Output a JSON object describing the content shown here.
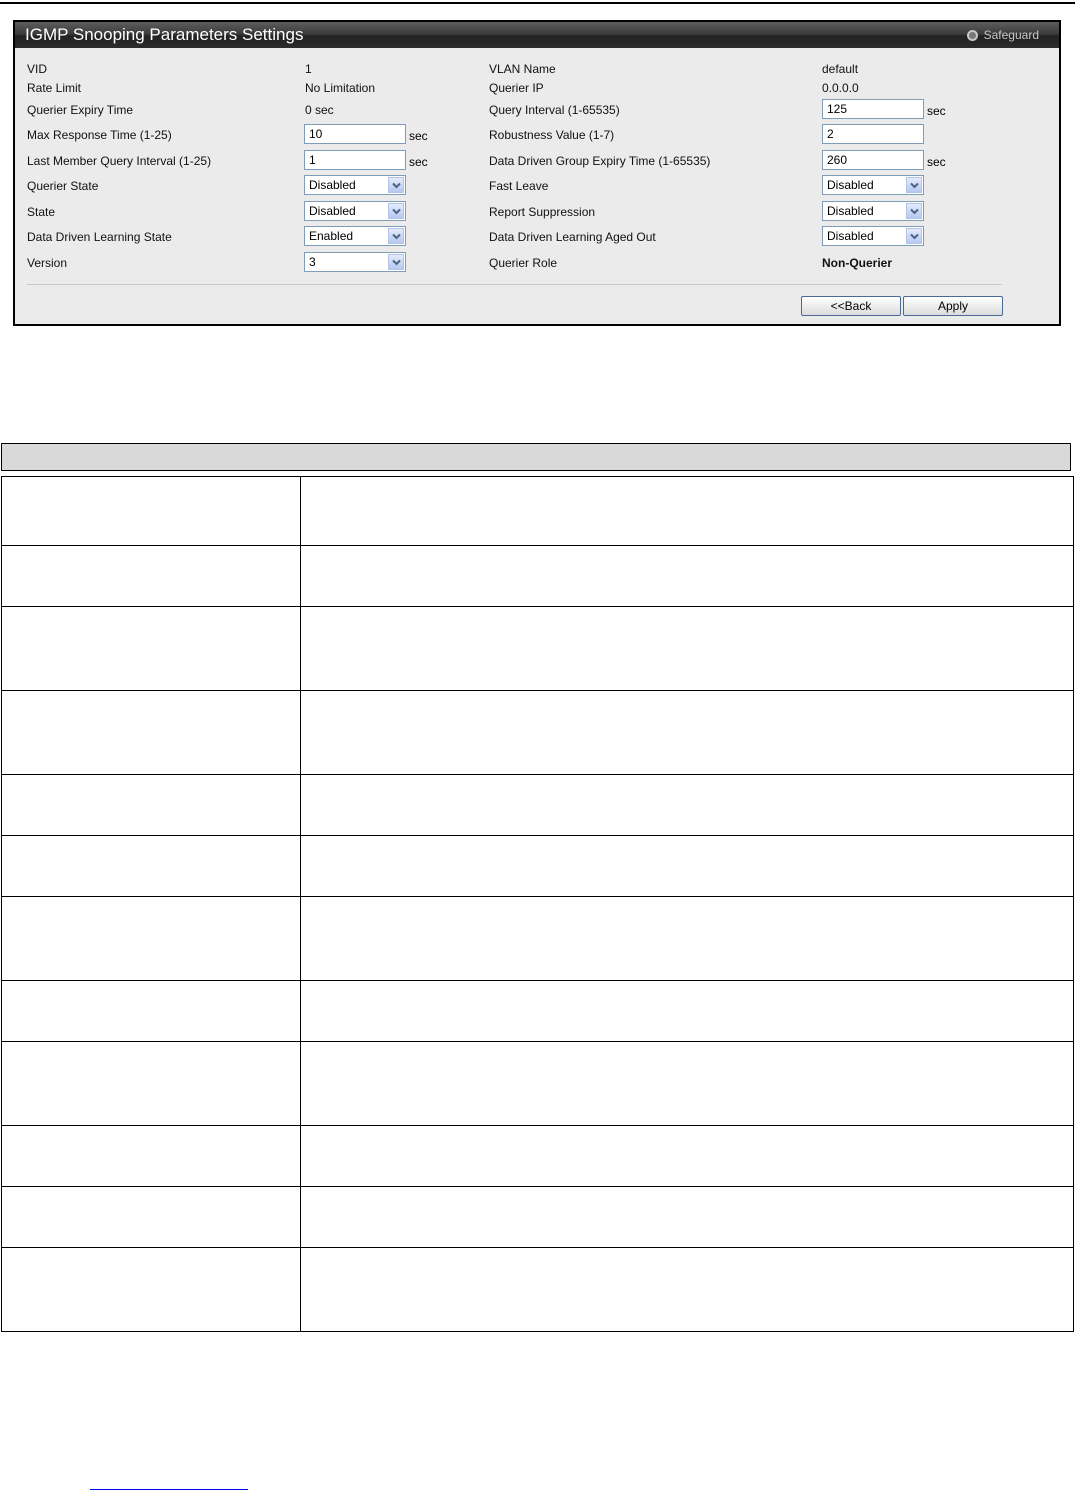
{
  "panel": {
    "title": "IGMP Snooping Parameters Settings",
    "safeguard_label": "Safeguard",
    "safeguard_icon": "circle-indicator-icon"
  },
  "fields": {
    "vid": {
      "label": "VID",
      "value": "1"
    },
    "rate_limit": {
      "label": "Rate Limit",
      "value": "No Limitation"
    },
    "querier_expiry_time": {
      "label": "Querier Expiry Time",
      "value": "0 sec"
    },
    "max_response_time": {
      "label": "Max Response Time (1-25)",
      "value": "10",
      "unit": "sec"
    },
    "last_member_query_interval": {
      "label": "Last Member Query Interval (1-25)",
      "value": "1",
      "unit": "sec"
    },
    "querier_state": {
      "label": "Querier State",
      "value": "Disabled"
    },
    "state": {
      "label": "State",
      "value": "Disabled"
    },
    "data_driven_learning_state": {
      "label": "Data Driven Learning State",
      "value": "Enabled"
    },
    "version": {
      "label": "Version",
      "value": "3"
    },
    "vlan_name": {
      "label": "VLAN Name",
      "value": "default"
    },
    "querier_ip": {
      "label": "Querier IP",
      "value": "0.0.0.0"
    },
    "query_interval": {
      "label": "Query Interval (1-65535)",
      "value": "125",
      "unit": "sec"
    },
    "robustness_value": {
      "label": "Robustness Value (1-7)",
      "value": "2"
    },
    "data_driven_group_expiry_time": {
      "label": "Data Driven Group Expiry Time (1-65535)",
      "value": "260",
      "unit": "sec"
    },
    "fast_leave": {
      "label": "Fast Leave",
      "value": "Disabled"
    },
    "report_suppression": {
      "label": "Report Suppression",
      "value": "Disabled"
    },
    "data_driven_learning_aged_out": {
      "label": "Data Driven Learning Aged Out",
      "value": "Disabled"
    },
    "querier_role": {
      "label": "Querier Role",
      "value": "Non-Querier"
    }
  },
  "buttons": {
    "back": "<<Back",
    "apply": "Apply"
  },
  "description_table": {
    "rows": 12
  }
}
